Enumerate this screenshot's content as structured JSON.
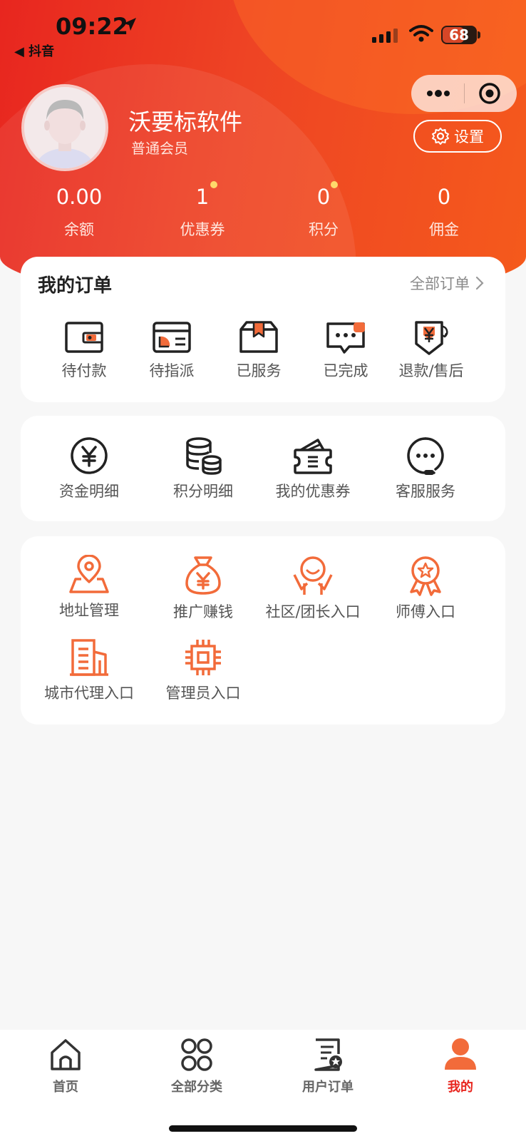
{
  "status_bar": {
    "time": "09:22",
    "back_app": "◀ 抖音",
    "battery": "68"
  },
  "header": {
    "settings_label": "设置"
  },
  "profile": {
    "name": "沃要标软件",
    "level": "普通会员"
  },
  "stats": [
    {
      "value": "0.00",
      "label": "余额",
      "dot": false
    },
    {
      "value": "1",
      "label": "优惠券",
      "dot": true
    },
    {
      "value": "0",
      "label": "积分",
      "dot": true
    },
    {
      "value": "0",
      "label": "佣金",
      "dot": false
    }
  ],
  "orders": {
    "title": "我的订单",
    "all_label": "全部订单",
    "items": [
      {
        "label": "待付款",
        "icon": "wallet-icon"
      },
      {
        "label": "待指派",
        "icon": "card-icon"
      },
      {
        "label": "已服务",
        "icon": "box-icon"
      },
      {
        "label": "已完成",
        "icon": "chat-complete-icon"
      },
      {
        "label": "退款/售后",
        "icon": "refund-icon"
      }
    ]
  },
  "services": [
    {
      "label": "资金明细",
      "icon": "yuan-circle-icon"
    },
    {
      "label": "积分明细",
      "icon": "coins-stack-icon"
    },
    {
      "label": "我的优惠券",
      "icon": "coupon-wallet-icon"
    },
    {
      "label": "客服服务",
      "icon": "customer-service-icon"
    }
  ],
  "tools": [
    {
      "label": "地址管理",
      "icon": "location-icon"
    },
    {
      "label": "推广赚钱",
      "icon": "money-bag-icon"
    },
    {
      "label": "社区/团长入口",
      "icon": "community-icon"
    },
    {
      "label": "师傅入口",
      "icon": "medal-icon"
    },
    {
      "label": "城市代理入口",
      "icon": "building-icon"
    },
    {
      "label": "管理员入口",
      "icon": "chip-icon"
    }
  ],
  "tabbar": [
    {
      "label": "首页",
      "icon": "home-icon",
      "active": false
    },
    {
      "label": "全部分类",
      "icon": "category-icon",
      "active": false
    },
    {
      "label": "用户订单",
      "icon": "order-doc-icon",
      "active": false
    },
    {
      "label": "我的",
      "icon": "user-icon",
      "active": true
    }
  ],
  "colors": {
    "primary": "#e8261f",
    "accent": "#f26b3a",
    "icon_dark": "#222222"
  }
}
